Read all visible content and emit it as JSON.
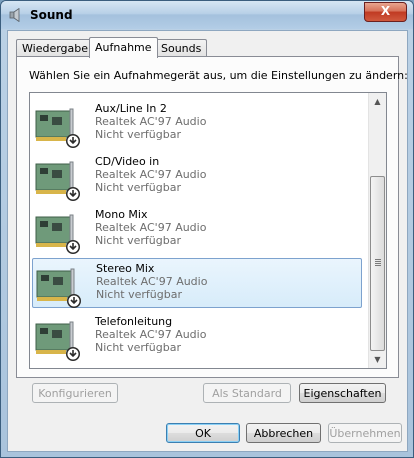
{
  "window": {
    "title": "Sound",
    "close_label": "X"
  },
  "tabs": [
    {
      "label": "Wiedergabe",
      "active": false
    },
    {
      "label": "Aufnahme",
      "active": true
    },
    {
      "label": "Sounds",
      "active": false
    }
  ],
  "panel": {
    "instruction": "Wählen Sie ein Aufnahmegerät aus, um die Einstellungen zu ändern:",
    "devices": [
      {
        "name": "Aux/Line In 2",
        "driver": "Realtek AC'97 Audio",
        "status": "Nicht verfügbar",
        "selected": false
      },
      {
        "name": "CD/Video in",
        "driver": "Realtek AC'97 Audio",
        "status": "Nicht verfügbar",
        "selected": false
      },
      {
        "name": "Mono Mix",
        "driver": "Realtek AC'97 Audio",
        "status": "Nicht verfügbar",
        "selected": false
      },
      {
        "name": "Stereo Mix",
        "driver": "Realtek AC'97 Audio",
        "status": "Nicht verfügbar",
        "selected": true
      },
      {
        "name": "Telefonleitung",
        "driver": "Realtek AC'97 Audio",
        "status": "Nicht verfügbar",
        "selected": false
      }
    ],
    "buttons": {
      "configure": "Konfigurieren",
      "set_default": "Als Standard",
      "properties": "Eigenschaften"
    }
  },
  "footer": {
    "ok": "OK",
    "cancel": "Abbrechen",
    "apply": "Übernehmen"
  },
  "icons": {
    "title": "speaker-icon",
    "device": "sound-card-icon"
  }
}
